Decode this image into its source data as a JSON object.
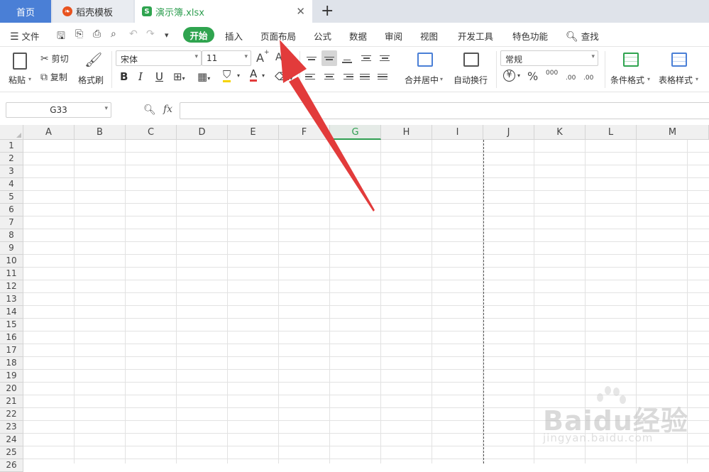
{
  "tabs": {
    "home": "首页",
    "daoke": "稻壳模板",
    "active": "演示簿.xlsx",
    "active_icon": "S",
    "close": "✕",
    "add": "+"
  },
  "menu": {
    "file": "文件",
    "start": "开始",
    "items": [
      "插入",
      "页面布局",
      "公式",
      "数据",
      "审阅",
      "视图",
      "开发工具",
      "特色功能"
    ],
    "search": "查找"
  },
  "ribbon": {
    "paste": "粘贴",
    "cut": "剪切",
    "copy": "复制",
    "format_painter": "格式刷",
    "font_name": "宋体",
    "font_size": "11",
    "bold": "B",
    "italic": "I",
    "underline": "U",
    "grow_font": "A",
    "shrink_font": "A",
    "font_color_letter": "A",
    "merge_center": "合并居中",
    "wrap_text": "自动换行",
    "number_format": "常规",
    "currency": "¥",
    "percent": "%",
    "thousands": "000",
    "dec_increase": ".00",
    "dec_decrease": ".00",
    "cond_format": "条件格式",
    "table_style": "表格样式"
  },
  "formula_bar": {
    "name_box": "G33",
    "fx": "fx",
    "value": ""
  },
  "sheet": {
    "columns": [
      "A",
      "B",
      "C",
      "D",
      "E",
      "F",
      "G",
      "H",
      "I",
      "J",
      "K",
      "L",
      "M"
    ],
    "selected_column": "G",
    "rows": [
      "1",
      "2",
      "3",
      "4",
      "5",
      "6",
      "7",
      "8",
      "9",
      "10",
      "11",
      "12",
      "13",
      "14",
      "15",
      "16",
      "17",
      "18",
      "19",
      "20",
      "21",
      "22",
      "23",
      "24",
      "25",
      "26"
    ]
  },
  "watermark": {
    "brand": "Baidu经验",
    "url": "jingyan.baidu.com"
  },
  "colors": {
    "accent_green": "#2fa44f",
    "home_tab_blue": "#4a7fd6",
    "arrow_red": "#e23b3b"
  }
}
